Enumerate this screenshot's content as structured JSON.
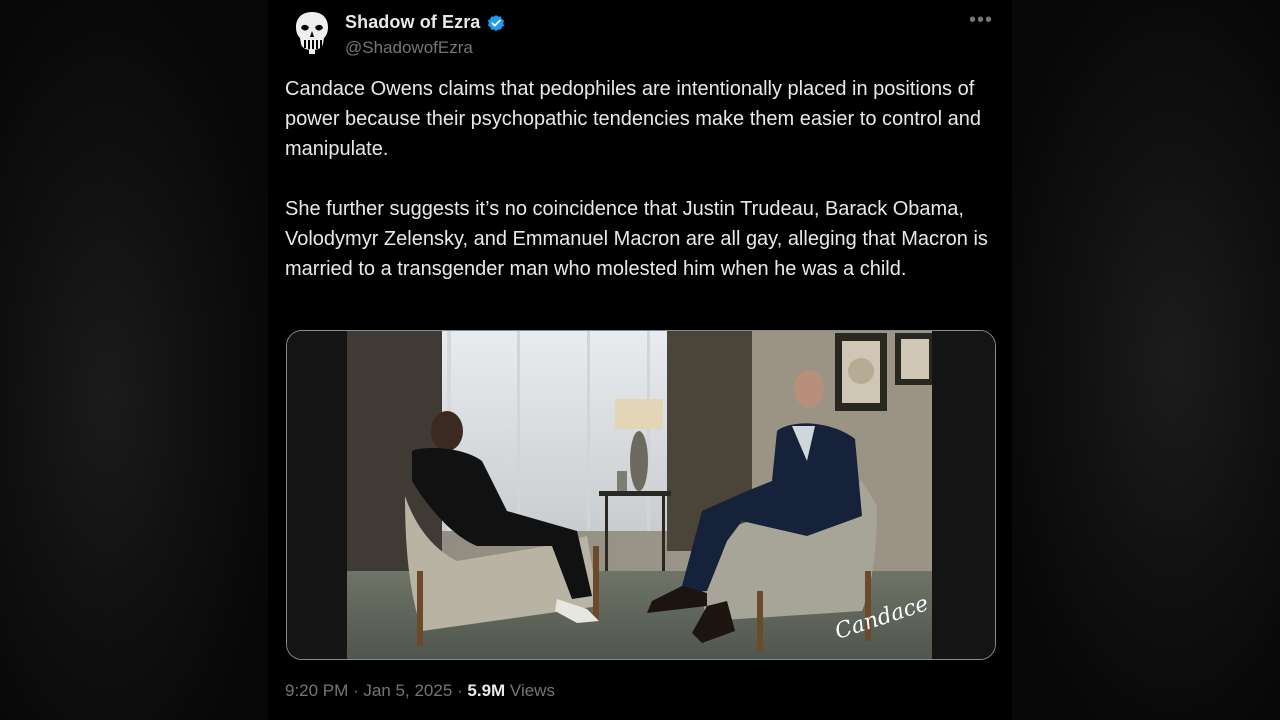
{
  "tweet": {
    "author": {
      "display_name": "Shadow of Ezra",
      "handle": "@ShadowofEzra",
      "verified": true,
      "avatar_icon": "punisher-skull-icon"
    },
    "more_label": "•••",
    "paragraphs": [
      "Candace Owens claims that pedophiles are intentionally placed in positions of power because their psychopathic tendencies make them easier to control and manipulate.",
      "She further suggests it’s no coincidence that Justin Trudeau, Barack Obama, Volodymyr Zelensky, and Emmanuel Macron are all gay, alleging that Macron is married to a transgender man who molested him when he was a child."
    ],
    "media": {
      "watermark": "Candace"
    },
    "meta": {
      "time": "9:20 PM",
      "separator": " · ",
      "date": "Jan 5, 2025",
      "views_count": "5.9M",
      "views_label": " Views"
    }
  },
  "colors": {
    "text_primary": "#e7e9ea",
    "text_secondary": "#71767b",
    "verified_blue": "#1d9bf0",
    "background": "#000000"
  }
}
